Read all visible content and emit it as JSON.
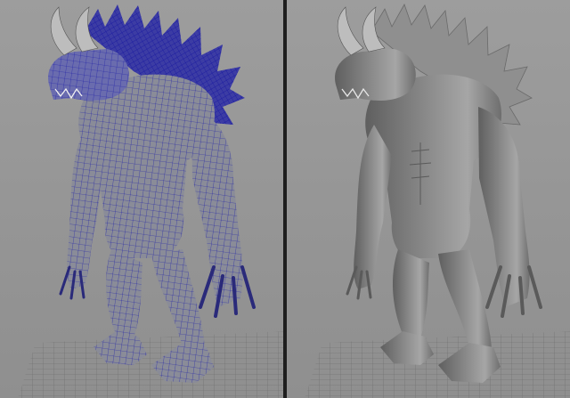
{
  "viewports": [
    {
      "id": "left",
      "shading": "wireframe-on-shaded",
      "wire_color": "#1a1aa8",
      "skin_color": "#8a8c98"
    },
    {
      "id": "right",
      "shading": "smooth-shaded",
      "skin_color": "#7b7b7b"
    }
  ],
  "colors": {
    "background": "#959595",
    "grid": "#6a6a6a",
    "horn": "#bdbdbd"
  }
}
